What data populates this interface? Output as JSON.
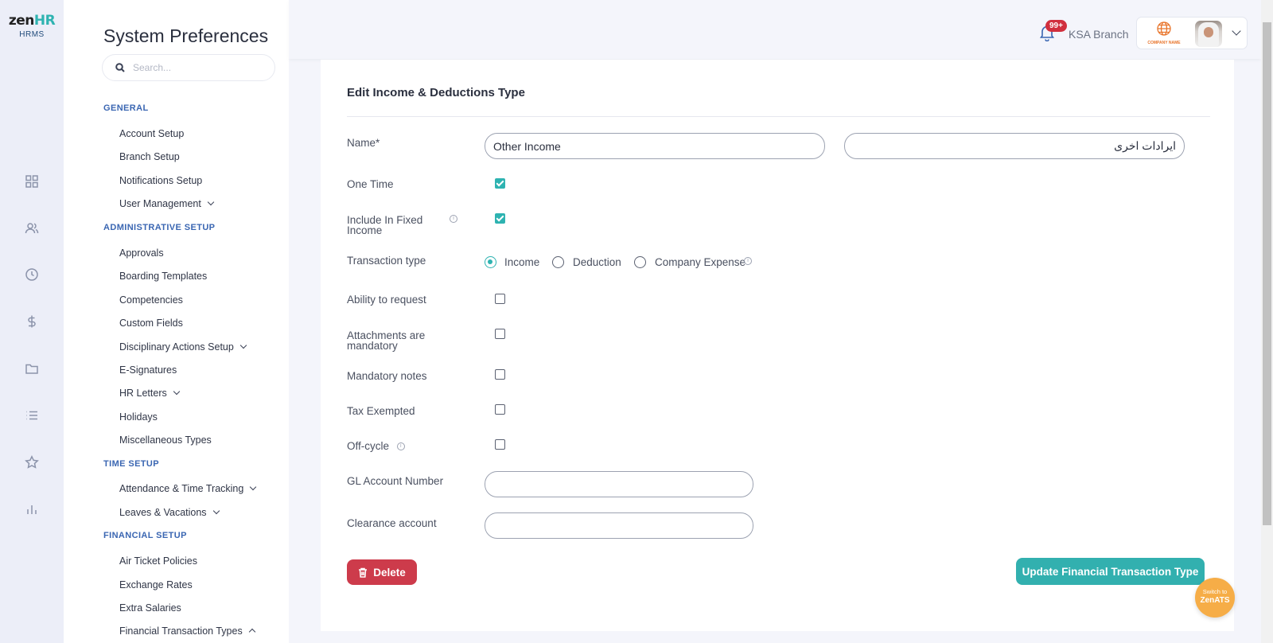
{
  "brand": {
    "logo_zen": "zen",
    "logo_hr": "HR",
    "product": "HRMS"
  },
  "rail": {
    "icons": [
      "dashboard-icon",
      "people-icon",
      "clock-icon",
      "dollar-icon",
      "folder-icon",
      "list-icon",
      "star-icon",
      "bar-chart-icon"
    ]
  },
  "sidebar": {
    "title": "System Preferences",
    "search_placeholder": "Search...",
    "sections": [
      {
        "label": "GENERAL"
      },
      {
        "label": "ADMINISTRATIVE SETUP"
      },
      {
        "label": "TIME SETUP"
      },
      {
        "label": "FINANCIAL SETUP"
      }
    ],
    "items": {
      "account_setup": "Account Setup",
      "branch_setup": "Branch Setup",
      "notifications_setup": "Notifications Setup",
      "user_management": "User Management",
      "approvals": "Approvals",
      "boarding_templates": "Boarding Templates",
      "competencies": "Competencies",
      "custom_fields": "Custom Fields",
      "disciplinary_actions_setup": "Disciplinary Actions Setup",
      "e_signatures": "E-Signatures",
      "hr_letters": "HR Letters",
      "holidays": "Holidays",
      "miscellaneous_types": "Miscellaneous Types",
      "attendance_time_tracking": "Attendance & Time Tracking",
      "leaves_vacations": "Leaves & Vacations",
      "air_ticket_policies": "Air Ticket Policies",
      "exchange_rates": "Exchange Rates",
      "extra_salaries": "Extra Salaries",
      "financial_transaction_types": "Financial Transaction Types"
    }
  },
  "header": {
    "notification_count": "99+",
    "branch": "KSA Branch",
    "company_logo_text": "COMPANY NAME"
  },
  "form": {
    "title": "Edit Income & Deductions Type",
    "name_label": "Name",
    "name_required_mark": "*",
    "name_en": "Other Income",
    "name_ar": "ايرادات اخرى",
    "one_time_label": "One Time",
    "one_time": true,
    "include_fixed_label": "Include In Fixed Income",
    "include_fixed": true,
    "transaction_type_label": "Transaction type",
    "transaction_options": [
      "Income",
      "Deduction",
      "Company Expense"
    ],
    "transaction_selected": "Income",
    "ability_request_label": "Ability to request",
    "attachments_label": "Attachments are mandatory",
    "mandatory_notes_label": "Mandatory notes",
    "tax_exempted_label": "Tax Exempted",
    "off_cycle_label": "Off-cycle",
    "gl_account_label": "GL Account Number",
    "gl_account_value": "",
    "clearance_label": "Clearance account",
    "clearance_value": "",
    "delete_label": "Delete",
    "update_label": "Update Financial Transaction Type"
  },
  "fab": {
    "line1": "Switch to",
    "line2": "ZenATS"
  },
  "colors": {
    "accent": "#2eb3b1",
    "danger": "#cd3b4b",
    "fab": "#f6ad47",
    "section": "#3a66b2",
    "badge": "#d12f3e"
  }
}
